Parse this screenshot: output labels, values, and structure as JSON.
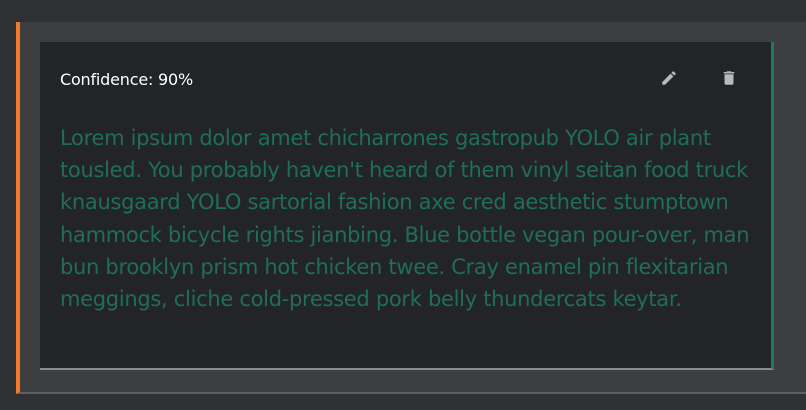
{
  "card": {
    "confidence_label": "Confidence: 90%",
    "body_text": "Lorem ipsum dolor amet chicharrones gastropub YOLO air plant tousled. You probably haven't heard of them vinyl seitan food truck knausgaard YOLO sartorial fashion axe cred aesthetic stumptown hammock bicycle rights jianbing. Blue bottle vegan pour-over, man bun brooklyn prism hot chicken twee. Cray enamel pin flexitarian meggings, cliche cold-pressed pork belly thundercats keytar.",
    "actions": {
      "edit_icon": "pencil-icon",
      "delete_icon": "trash-icon"
    }
  },
  "colors": {
    "accent_left": "#f07a2a",
    "accent_right": "#1f7a5b",
    "body_text": "#1f6f56",
    "card_bg": "#232426"
  }
}
